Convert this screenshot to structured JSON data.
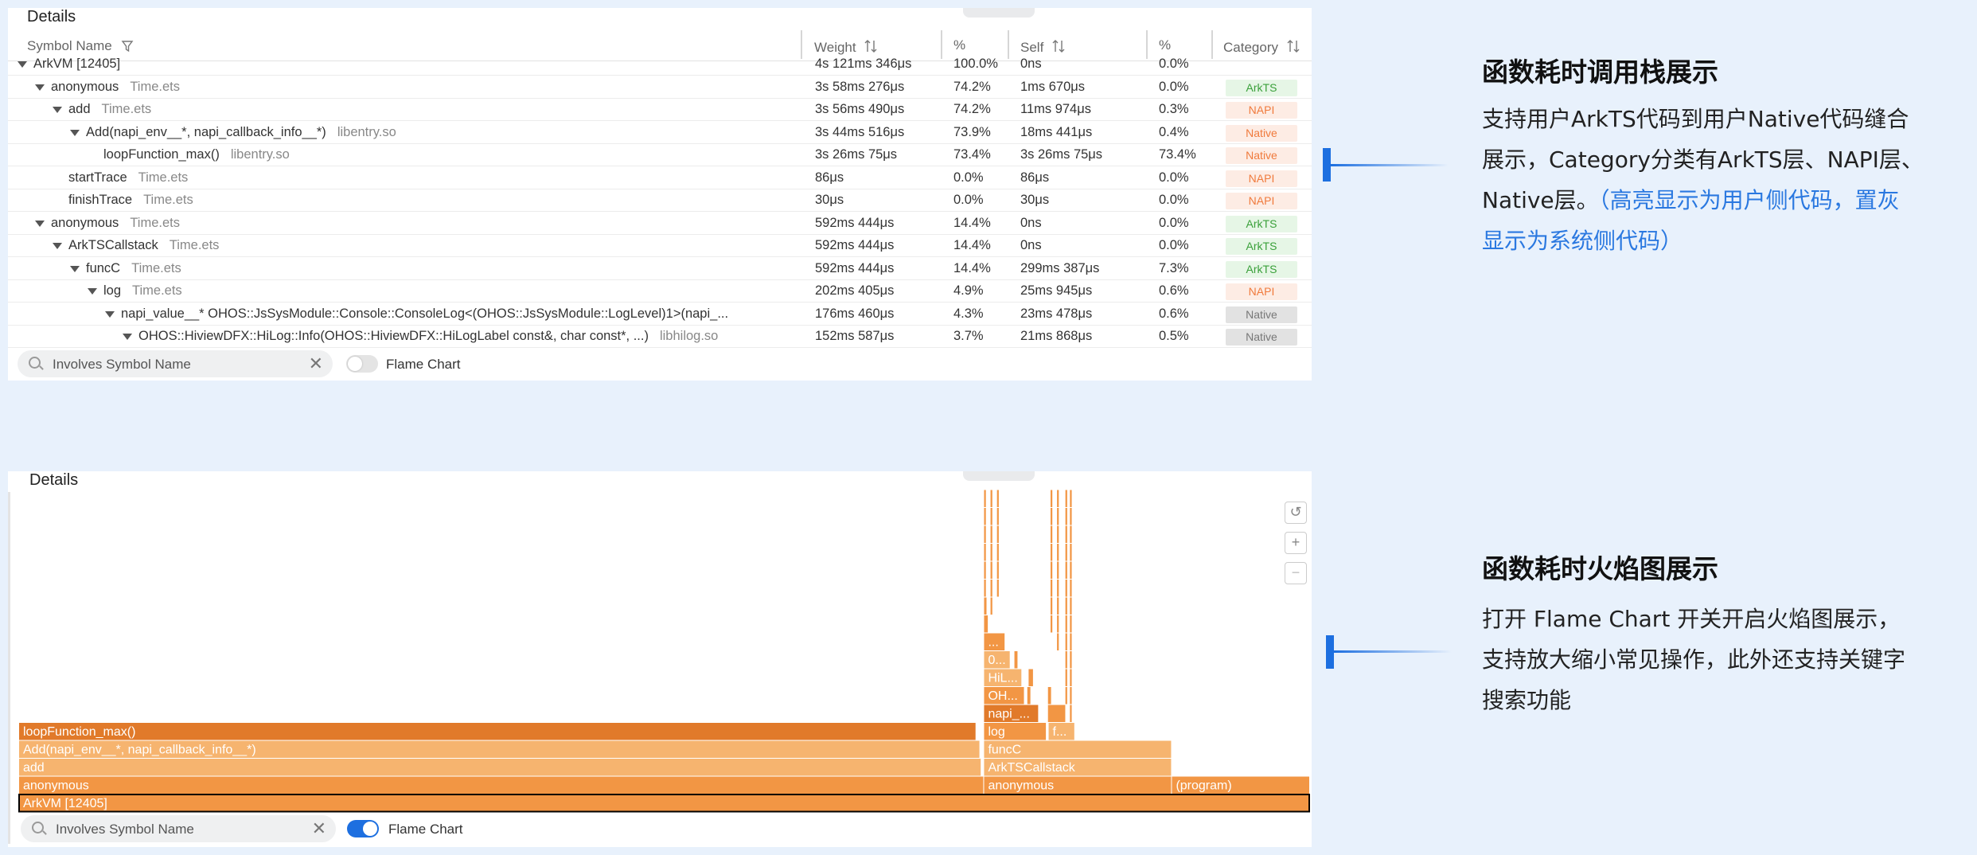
{
  "top_panel": {
    "title": "Details",
    "columns": [
      "Symbol Name",
      "Weight",
      "%",
      "Self",
      "%",
      "Category"
    ],
    "rows": [
      {
        "indent": 0,
        "expanded": true,
        "symbol": "ArkVM [12405]",
        "file": "",
        "weight": "4s 121ms 346μs",
        "pct": "100.0%",
        "self": "0ns",
        "self_pct": "0.0%",
        "category": "",
        "cat_style": ""
      },
      {
        "indent": 1,
        "expanded": true,
        "symbol": "anonymous",
        "file": "Time.ets",
        "weight": "3s 58ms 276μs",
        "pct": "74.2%",
        "self": "1ms 670μs",
        "self_pct": "0.0%",
        "category": "ArkTS",
        "cat_style": "arkts"
      },
      {
        "indent": 2,
        "expanded": true,
        "symbol": "add",
        "file": "Time.ets",
        "weight": "3s 56ms 490μs",
        "pct": "74.2%",
        "self": "11ms 974μs",
        "self_pct": "0.3%",
        "category": "NAPI",
        "cat_style": "napi"
      },
      {
        "indent": 3,
        "expanded": true,
        "symbol": "Add(napi_env__*, napi_callback_info__*)",
        "file": "libentry.so",
        "weight": "3s 44ms 516μs",
        "pct": "73.9%",
        "self": "18ms 441μs",
        "self_pct": "0.4%",
        "category": "Native",
        "cat_style": "native"
      },
      {
        "indent": 4,
        "expanded": false,
        "symbol": "loopFunction_max()",
        "file": "libentry.so",
        "weight": "3s 26ms 75μs",
        "pct": "73.4%",
        "self": "3s 26ms 75μs",
        "self_pct": "73.4%",
        "category": "Native",
        "cat_style": "native"
      },
      {
        "indent": 2,
        "expanded": false,
        "symbol": "startTrace",
        "file": "Time.ets",
        "weight": "86μs",
        "pct": "0.0%",
        "self": "86μs",
        "self_pct": "0.0%",
        "category": "NAPI",
        "cat_style": "napi"
      },
      {
        "indent": 2,
        "expanded": false,
        "symbol": "finishTrace",
        "file": "Time.ets",
        "weight": "30μs",
        "pct": "0.0%",
        "self": "30μs",
        "self_pct": "0.0%",
        "category": "NAPI",
        "cat_style": "napi"
      },
      {
        "indent": 1,
        "expanded": true,
        "symbol": "anonymous",
        "file": "Time.ets",
        "weight": "592ms 444μs",
        "pct": "14.4%",
        "self": "0ns",
        "self_pct": "0.0%",
        "category": "ArkTS",
        "cat_style": "arkts"
      },
      {
        "indent": 2,
        "expanded": true,
        "symbol": "ArkTSCallstack",
        "file": "Time.ets",
        "weight": "592ms 444μs",
        "pct": "14.4%",
        "self": "0ns",
        "self_pct": "0.0%",
        "category": "ArkTS",
        "cat_style": "arkts"
      },
      {
        "indent": 3,
        "expanded": true,
        "symbol": "funcC",
        "file": "Time.ets",
        "weight": "592ms 444μs",
        "pct": "14.4%",
        "self": "299ms 387μs",
        "self_pct": "7.3%",
        "category": "ArkTS",
        "cat_style": "arkts"
      },
      {
        "indent": 4,
        "expanded": true,
        "symbol": "log",
        "file": "Time.ets",
        "weight": "202ms 405μs",
        "pct": "4.9%",
        "self": "25ms 945μs",
        "self_pct": "0.6%",
        "category": "NAPI",
        "cat_style": "napi"
      },
      {
        "indent": 5,
        "expanded": true,
        "symbol": "napi_value__* OHOS::JsSysModule::Console::ConsoleLog<(OHOS::JsSysModule::LogLevel)1>(napi_...",
        "file": "",
        "weight": "176ms 460μs",
        "pct": "4.3%",
        "self": "23ms 478μs",
        "self_pct": "0.6%",
        "category": "Native",
        "cat_style": "native-g"
      },
      {
        "indent": 6,
        "expanded": true,
        "symbol": "OHOS::HiviewDFX::HiLog::Info(OHOS::HiviewDFX::HiLogLabel const&, char const*, ...)",
        "file": "libhilog.so",
        "weight": "152ms 587μs",
        "pct": "3.7%",
        "self": "21ms 868μs",
        "self_pct": "0.5%",
        "category": "Native",
        "cat_style": "native-g"
      }
    ],
    "search_placeholder": "Involves Symbol Name",
    "toggle_label": "Flame Chart",
    "toggle_on": false
  },
  "bottom_panel": {
    "title": "Details",
    "search_placeholder": "Involves Symbol Name",
    "toggle_label": "Flame Chart",
    "toggle_on": true,
    "zoom_icons": [
      "reset-zoom-icon",
      "zoom-in-icon",
      "zoom-out-icon"
    ],
    "colors": {
      "light": "#f6b46f",
      "mid": "#f29644",
      "dark": "#e17a2a",
      "root_border": "#000000"
    },
    "frames": [
      {
        "label": "ArkVM [12405]",
        "start": 0.0,
        "end": 1.0,
        "depth": 0,
        "tone": "mid",
        "root": true
      },
      {
        "label": "anonymous",
        "start": 0.0,
        "end": 0.7475,
        "depth": 1,
        "tone": "mid"
      },
      {
        "label": "anonymous",
        "start": 0.7475,
        "end": 0.893,
        "depth": 1,
        "tone": "mid"
      },
      {
        "label": "(program)",
        "start": 0.893,
        "end": 1.0,
        "depth": 1,
        "tone": "mid"
      },
      {
        "label": "add",
        "start": 0.0,
        "end": 0.7455,
        "depth": 2,
        "tone": "light"
      },
      {
        "label": "ArkTSCallstack",
        "start": 0.7475,
        "end": 0.893,
        "depth": 2,
        "tone": "light"
      },
      {
        "label": "Add(napi_env__*, napi_callback_info__*)",
        "start": 0.0,
        "end": 0.7445,
        "depth": 3,
        "tone": "light"
      },
      {
        "label": "funcC",
        "start": 0.7475,
        "end": 0.893,
        "depth": 3,
        "tone": "light"
      },
      {
        "label": "loopFunction_max()",
        "start": 0.0,
        "end": 0.7415,
        "depth": 4,
        "tone": "dark"
      },
      {
        "label": "log",
        "start": 0.7475,
        "end": 0.796,
        "depth": 4,
        "tone": "mid"
      },
      {
        "label": "f...",
        "start": 0.7975,
        "end": 0.818,
        "depth": 4,
        "tone": "light"
      },
      {
        "label": "napi_...",
        "start": 0.7475,
        "end": 0.79,
        "depth": 5,
        "tone": "dark"
      },
      {
        "label": "",
        "start": 0.797,
        "end": 0.811,
        "depth": 5,
        "tone": "mid"
      },
      {
        "label": "OH...",
        "start": 0.7475,
        "end": 0.779,
        "depth": 6,
        "tone": "mid"
      },
      {
        "label": "",
        "start": 0.781,
        "end": 0.784,
        "depth": 6,
        "tone": "mid"
      },
      {
        "label": "",
        "start": 0.797,
        "end": 0.8,
        "depth": 6,
        "tone": "mid"
      },
      {
        "label": "HiL...",
        "start": 0.7475,
        "end": 0.777,
        "depth": 7,
        "tone": "light"
      },
      {
        "label": "",
        "start": 0.782,
        "end": 0.786,
        "depth": 7,
        "tone": "mid"
      },
      {
        "label": "0...",
        "start": 0.7475,
        "end": 0.768,
        "depth": 8,
        "tone": "light"
      },
      {
        "label": "",
        "start": 0.771,
        "end": 0.774,
        "depth": 8,
        "tone": "mid"
      },
      {
        "label": "...",
        "start": 0.7475,
        "end": 0.764,
        "depth": 9,
        "tone": "mid"
      },
      {
        "label": "",
        "start": 0.7475,
        "end": 0.751,
        "depth": 10,
        "tone": "mid"
      },
      {
        "label": "",
        "start": 0.7475,
        "end": 0.75,
        "depth": 11,
        "tone": "mid"
      },
      {
        "label": "",
        "start": 0.7525,
        "end": 0.7545,
        "depth": 11,
        "tone": "mid"
      },
      {
        "label": "",
        "start": 0.799,
        "end": 0.801,
        "depth": 10,
        "tone": "mid"
      },
      {
        "label": "",
        "start": 0.7475,
        "end": 0.7495,
        "depth": 12,
        "tone": "mid"
      },
      {
        "label": "",
        "start": 0.7525,
        "end": 0.7545,
        "depth": 12,
        "tone": "mid"
      },
      {
        "label": "",
        "start": 0.7575,
        "end": 0.7595,
        "depth": 12,
        "tone": "mid"
      },
      {
        "label": "",
        "start": 0.7475,
        "end": 0.7495,
        "depth": 13,
        "tone": "mid"
      },
      {
        "label": "",
        "start": 0.7525,
        "end": 0.7545,
        "depth": 13,
        "tone": "mid"
      },
      {
        "label": "",
        "start": 0.7575,
        "end": 0.7595,
        "depth": 13,
        "tone": "mid"
      },
      {
        "label": "",
        "start": 0.7475,
        "end": 0.7495,
        "depth": 14,
        "tone": "mid"
      },
      {
        "label": "",
        "start": 0.7525,
        "end": 0.7545,
        "depth": 14,
        "tone": "mid"
      },
      {
        "label": "",
        "start": 0.7575,
        "end": 0.7595,
        "depth": 14,
        "tone": "mid"
      },
      {
        "label": "",
        "start": 0.7475,
        "end": 0.7495,
        "depth": 15,
        "tone": "mid"
      },
      {
        "label": "",
        "start": 0.7525,
        "end": 0.7545,
        "depth": 15,
        "tone": "mid"
      },
      {
        "label": "",
        "start": 0.7575,
        "end": 0.7595,
        "depth": 15,
        "tone": "mid"
      },
      {
        "label": "",
        "start": 0.7475,
        "end": 0.7495,
        "depth": 16,
        "tone": "mid"
      },
      {
        "label": "",
        "start": 0.7525,
        "end": 0.7545,
        "depth": 16,
        "tone": "mid"
      },
      {
        "label": "",
        "start": 0.7575,
        "end": 0.7595,
        "depth": 16,
        "tone": "mid"
      },
      {
        "label": "",
        "start": 0.7475,
        "end": 0.7495,
        "depth": 17,
        "tone": "mid"
      },
      {
        "label": "",
        "start": 0.7525,
        "end": 0.7545,
        "depth": 17,
        "tone": "mid"
      },
      {
        "label": "",
        "start": 0.7575,
        "end": 0.7595,
        "depth": 17,
        "tone": "mid"
      },
      {
        "label": "",
        "start": 0.799,
        "end": 0.801,
        "depth": 11,
        "tone": "mid"
      },
      {
        "label": "",
        "start": 0.799,
        "end": 0.801,
        "depth": 12,
        "tone": "mid"
      },
      {
        "label": "",
        "start": 0.799,
        "end": 0.801,
        "depth": 13,
        "tone": "mid"
      },
      {
        "label": "",
        "start": 0.799,
        "end": 0.801,
        "depth": 14,
        "tone": "mid"
      },
      {
        "label": "",
        "start": 0.799,
        "end": 0.801,
        "depth": 15,
        "tone": "mid"
      },
      {
        "label": "",
        "start": 0.799,
        "end": 0.801,
        "depth": 16,
        "tone": "mid"
      },
      {
        "label": "",
        "start": 0.799,
        "end": 0.801,
        "depth": 17,
        "tone": "mid"
      },
      {
        "label": "",
        "start": 0.804,
        "end": 0.806,
        "depth": 9,
        "tone": "mid"
      },
      {
        "label": "",
        "start": 0.804,
        "end": 0.806,
        "depth": 10,
        "tone": "mid"
      },
      {
        "label": "",
        "start": 0.804,
        "end": 0.806,
        "depth": 11,
        "tone": "mid"
      },
      {
        "label": "",
        "start": 0.804,
        "end": 0.806,
        "depth": 12,
        "tone": "mid"
      },
      {
        "label": "",
        "start": 0.804,
        "end": 0.806,
        "depth": 13,
        "tone": "mid"
      },
      {
        "label": "",
        "start": 0.804,
        "end": 0.806,
        "depth": 14,
        "tone": "mid"
      },
      {
        "label": "",
        "start": 0.804,
        "end": 0.806,
        "depth": 15,
        "tone": "mid"
      },
      {
        "label": "",
        "start": 0.804,
        "end": 0.806,
        "depth": 16,
        "tone": "mid"
      },
      {
        "label": "",
        "start": 0.804,
        "end": 0.806,
        "depth": 17,
        "tone": "mid"
      },
      {
        "label": "",
        "start": 0.8105,
        "end": 0.8125,
        "depth": 6,
        "tone": "mid"
      },
      {
        "label": "",
        "start": 0.8105,
        "end": 0.8125,
        "depth": 7,
        "tone": "mid"
      },
      {
        "label": "",
        "start": 0.8105,
        "end": 0.8125,
        "depth": 8,
        "tone": "mid"
      },
      {
        "label": "",
        "start": 0.8105,
        "end": 0.8125,
        "depth": 9,
        "tone": "mid"
      },
      {
        "label": "",
        "start": 0.8105,
        "end": 0.8125,
        "depth": 10,
        "tone": "mid"
      },
      {
        "label": "",
        "start": 0.8105,
        "end": 0.8125,
        "depth": 11,
        "tone": "mid"
      },
      {
        "label": "",
        "start": 0.8105,
        "end": 0.8125,
        "depth": 12,
        "tone": "mid"
      },
      {
        "label": "",
        "start": 0.8105,
        "end": 0.8125,
        "depth": 13,
        "tone": "mid"
      },
      {
        "label": "",
        "start": 0.8105,
        "end": 0.8125,
        "depth": 14,
        "tone": "mid"
      },
      {
        "label": "",
        "start": 0.8105,
        "end": 0.8125,
        "depth": 15,
        "tone": "mid"
      },
      {
        "label": "",
        "start": 0.8105,
        "end": 0.8125,
        "depth": 16,
        "tone": "mid"
      },
      {
        "label": "",
        "start": 0.8105,
        "end": 0.8125,
        "depth": 17,
        "tone": "mid"
      },
      {
        "label": "",
        "start": 0.814,
        "end": 0.816,
        "depth": 5,
        "tone": "mid"
      },
      {
        "label": "",
        "start": 0.814,
        "end": 0.816,
        "depth": 6,
        "tone": "mid"
      },
      {
        "label": "",
        "start": 0.814,
        "end": 0.816,
        "depth": 7,
        "tone": "mid"
      },
      {
        "label": "",
        "start": 0.814,
        "end": 0.816,
        "depth": 8,
        "tone": "mid"
      },
      {
        "label": "",
        "start": 0.814,
        "end": 0.816,
        "depth": 9,
        "tone": "mid"
      },
      {
        "label": "",
        "start": 0.814,
        "end": 0.816,
        "depth": 10,
        "tone": "mid"
      },
      {
        "label": "",
        "start": 0.814,
        "end": 0.816,
        "depth": 11,
        "tone": "mid"
      },
      {
        "label": "",
        "start": 0.814,
        "end": 0.816,
        "depth": 12,
        "tone": "mid"
      },
      {
        "label": "",
        "start": 0.814,
        "end": 0.816,
        "depth": 13,
        "tone": "mid"
      },
      {
        "label": "",
        "start": 0.814,
        "end": 0.816,
        "depth": 14,
        "tone": "mid"
      },
      {
        "label": "",
        "start": 0.814,
        "end": 0.816,
        "depth": 15,
        "tone": "mid"
      },
      {
        "label": "",
        "start": 0.814,
        "end": 0.816,
        "depth": 16,
        "tone": "mid"
      },
      {
        "label": "",
        "start": 0.814,
        "end": 0.816,
        "depth": 17,
        "tone": "mid"
      }
    ]
  },
  "annotations": {
    "section1_title": "函数耗时调用栈展示",
    "section1_line1": "支持用户ArkTS代码到用户Native代码缝合",
    "section1_line2": "展示，Category分类有ArkTS层、NAPI层、",
    "section1_line3_black": "Native层。",
    "section1_line3_blue": "（高亮显示为用户侧代码，置灰",
    "section1_line4_blue": "显示为系统侧代码）",
    "section2_title": "函数耗时火焰图展示",
    "section2_line1": "打开 Flame Chart 开关开启火焰图展示，",
    "section2_line2": "支持放大缩小常见操作，此外还支持关键字",
    "section2_line3": "搜索功能",
    "accent_color": "#1d6fe0"
  }
}
